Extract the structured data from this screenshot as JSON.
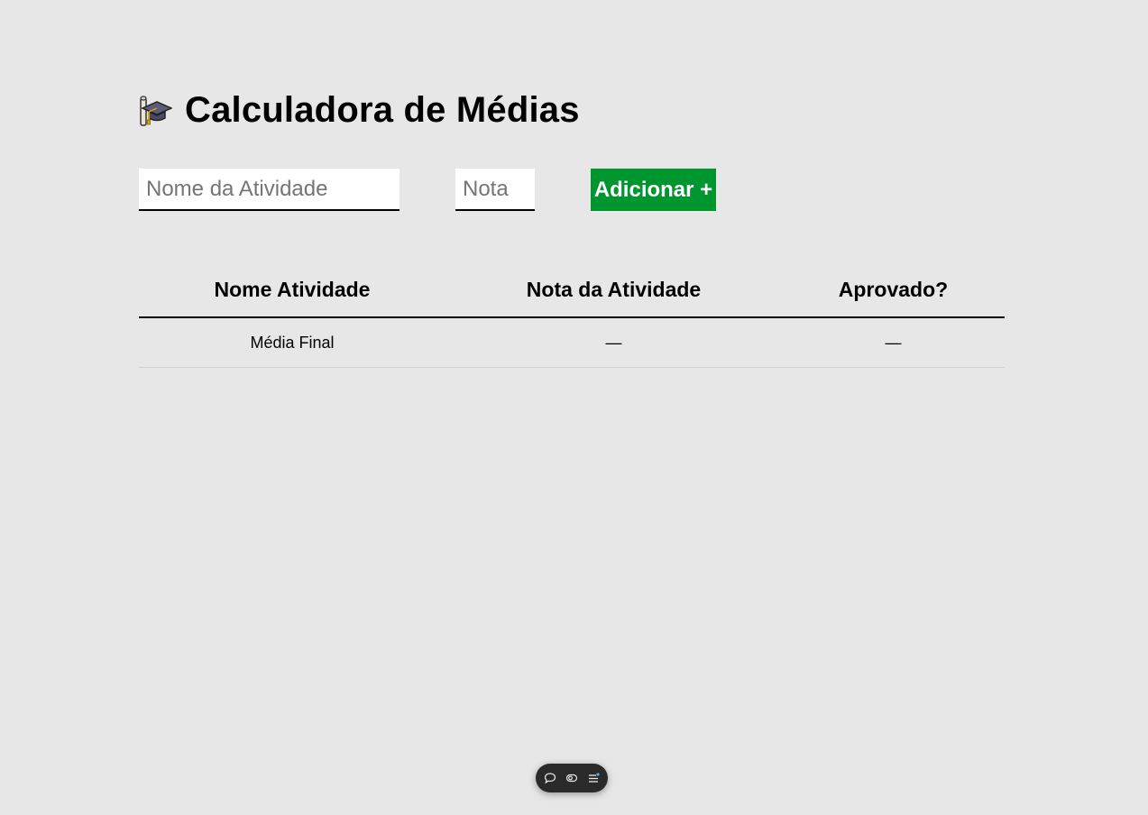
{
  "header": {
    "icon": "graduation-cap-icon",
    "title": "Calculadora de Médias"
  },
  "form": {
    "name_placeholder": "Nome da Atividade",
    "name_value": "",
    "grade_placeholder": "Nota",
    "grade_value": "",
    "add_button_label": "Adicionar +",
    "add_button_color": "#00962f"
  },
  "table": {
    "headers": [
      "Nome Atividade",
      "Nota da Atividade",
      "Aprovado?"
    ],
    "footer_row": {
      "name": "Média Final",
      "grade": "—",
      "approved": "—"
    }
  },
  "toolbar": {
    "icons": [
      "comment-icon",
      "toggle-view-icon",
      "menu-list-icon"
    ]
  }
}
